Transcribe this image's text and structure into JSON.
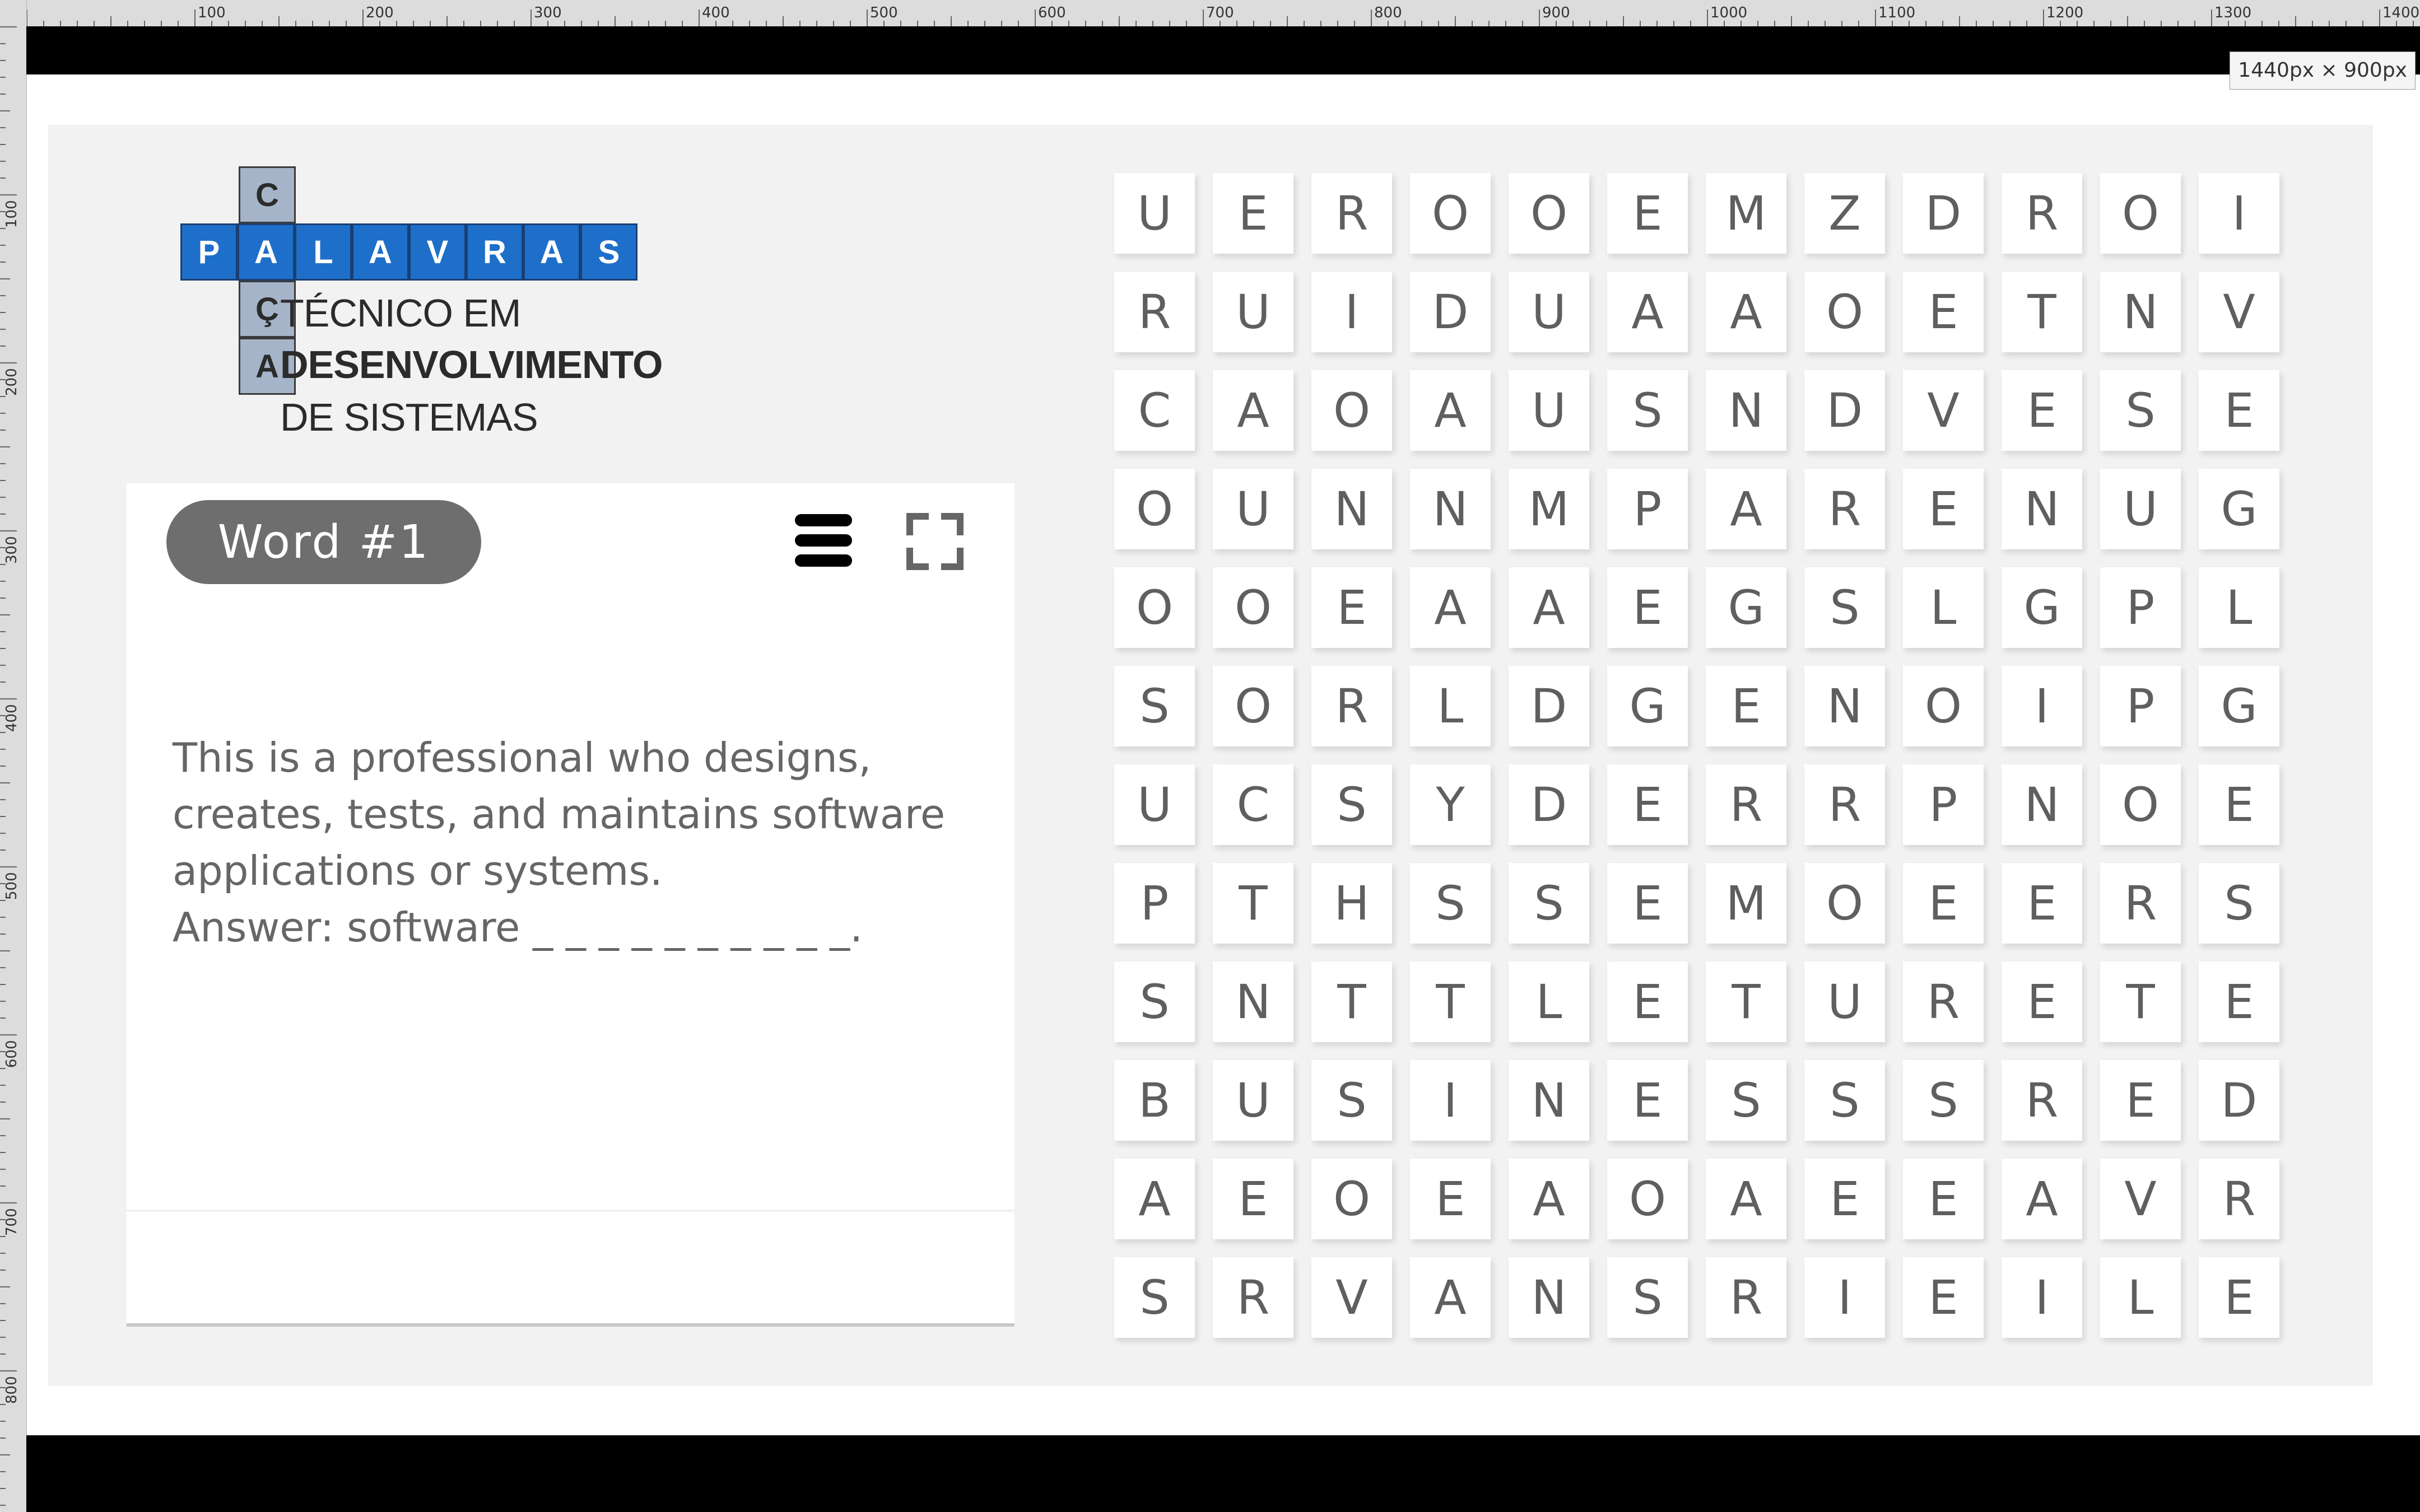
{
  "ruler": {
    "top_labels": [
      "100",
      "200",
      "300",
      "400",
      "500",
      "600",
      "700",
      "800",
      "900",
      "1000",
      "1100",
      "1200",
      "1300",
      "1400"
    ],
    "left_labels": [
      "100",
      "200",
      "300",
      "400",
      "500",
      "600",
      "700",
      "800"
    ]
  },
  "viewport_label": "1440px × 900px",
  "logo": {
    "vertical_letters": [
      "C",
      "Ç",
      "A"
    ],
    "horizontal_letters": [
      "P",
      "A",
      "L",
      "A",
      "V",
      "R",
      "A",
      "S"
    ],
    "line1": "TÉCNICO EM",
    "line2": "DESENVOLVIMENTO",
    "line3": "DE SISTEMAS"
  },
  "clue_card": {
    "word_label": "Word #1",
    "clue_line1": "This is a professional who designs,",
    "clue_line2": "creates, tests, and maintains software",
    "clue_line3": "applications or systems.",
    "answer_line": "Answer: software _ _ _ _ _ _ _ _ _ _."
  },
  "icons": {
    "menu": "hamburger-menu-icon",
    "fullscreen": "fullscreen-icon"
  },
  "grid": [
    [
      "U",
      "E",
      "R",
      "O",
      "O",
      "E",
      "M",
      "Z",
      "D",
      "R",
      "O",
      "I"
    ],
    [
      "R",
      "U",
      "I",
      "D",
      "U",
      "A",
      "A",
      "O",
      "E",
      "T",
      "N",
      "V"
    ],
    [
      "C",
      "A",
      "O",
      "A",
      "U",
      "S",
      "N",
      "D",
      "V",
      "E",
      "S",
      "E"
    ],
    [
      "O",
      "U",
      "N",
      "N",
      "M",
      "P",
      "A",
      "R",
      "E",
      "N",
      "U",
      "G"
    ],
    [
      "O",
      "O",
      "E",
      "A",
      "A",
      "E",
      "G",
      "S",
      "L",
      "G",
      "P",
      "L"
    ],
    [
      "S",
      "O",
      "R",
      "L",
      "D",
      "G",
      "E",
      "N",
      "O",
      "I",
      "P",
      "G"
    ],
    [
      "U",
      "C",
      "S",
      "Y",
      "D",
      "E",
      "R",
      "R",
      "P",
      "N",
      "O",
      "E"
    ],
    [
      "P",
      "T",
      "H",
      "S",
      "S",
      "E",
      "M",
      "O",
      "E",
      "E",
      "R",
      "S"
    ],
    [
      "S",
      "N",
      "T",
      "T",
      "L",
      "E",
      "T",
      "U",
      "R",
      "E",
      "T",
      "E"
    ],
    [
      "B",
      "U",
      "S",
      "I",
      "N",
      "E",
      "S",
      "S",
      "S",
      "R",
      "E",
      "D"
    ],
    [
      "A",
      "E",
      "O",
      "E",
      "A",
      "O",
      "A",
      "E",
      "E",
      "A",
      "V",
      "R"
    ],
    [
      "S",
      "R",
      "V",
      "A",
      "N",
      "S",
      "R",
      "I",
      "E",
      "I",
      "L",
      "E"
    ]
  ],
  "colors": {
    "game_bg": "#f2f2f2",
    "logo_blue": "#1e6fc9",
    "logo_grey": "#a5b4c8",
    "pill_bg": "#6e6e6e",
    "letter": "#5f5f5f"
  }
}
